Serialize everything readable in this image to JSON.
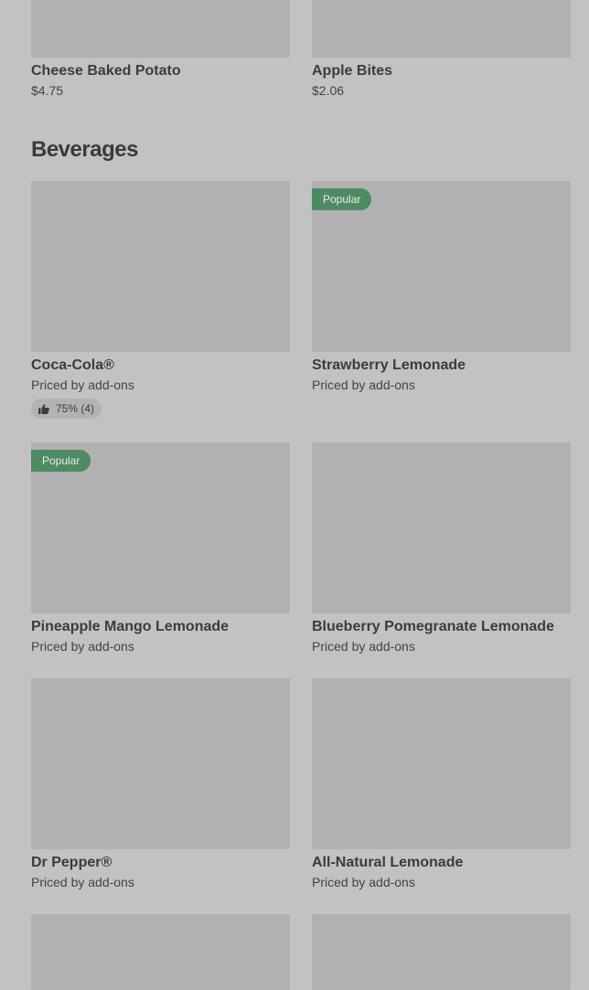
{
  "top_items": [
    {
      "name": "Cheese Baked Potato",
      "price": "$4.75"
    },
    {
      "name": "Apple Bites",
      "price": "$2.06"
    }
  ],
  "section": {
    "title": "Beverages"
  },
  "beverages": [
    {
      "name": "Coca-Cola®",
      "price": "Priced by add-ons",
      "badge": "",
      "rating": "75% (4)"
    },
    {
      "name": "Strawberry Lemonade",
      "price": "Priced by add-ons",
      "badge": "Popular"
    },
    {
      "name": "Pineapple Mango Lemonade",
      "price": "Priced by add-ons",
      "badge": "Popular"
    },
    {
      "name": "Blueberry Pomegranate Lemonade",
      "price": "Priced by add-ons"
    },
    {
      "name": "Dr Pepper®",
      "price": "Priced by add-ons"
    },
    {
      "name": "All-Natural Lemonade",
      "price": "Priced by add-ons"
    }
  ],
  "colors": {
    "background": "#c2c2c2",
    "image_placeholder": "#b1b1b1",
    "popular_badge": "#4e8a63"
  },
  "icons": {
    "rating": "thumbs-up-icon"
  }
}
